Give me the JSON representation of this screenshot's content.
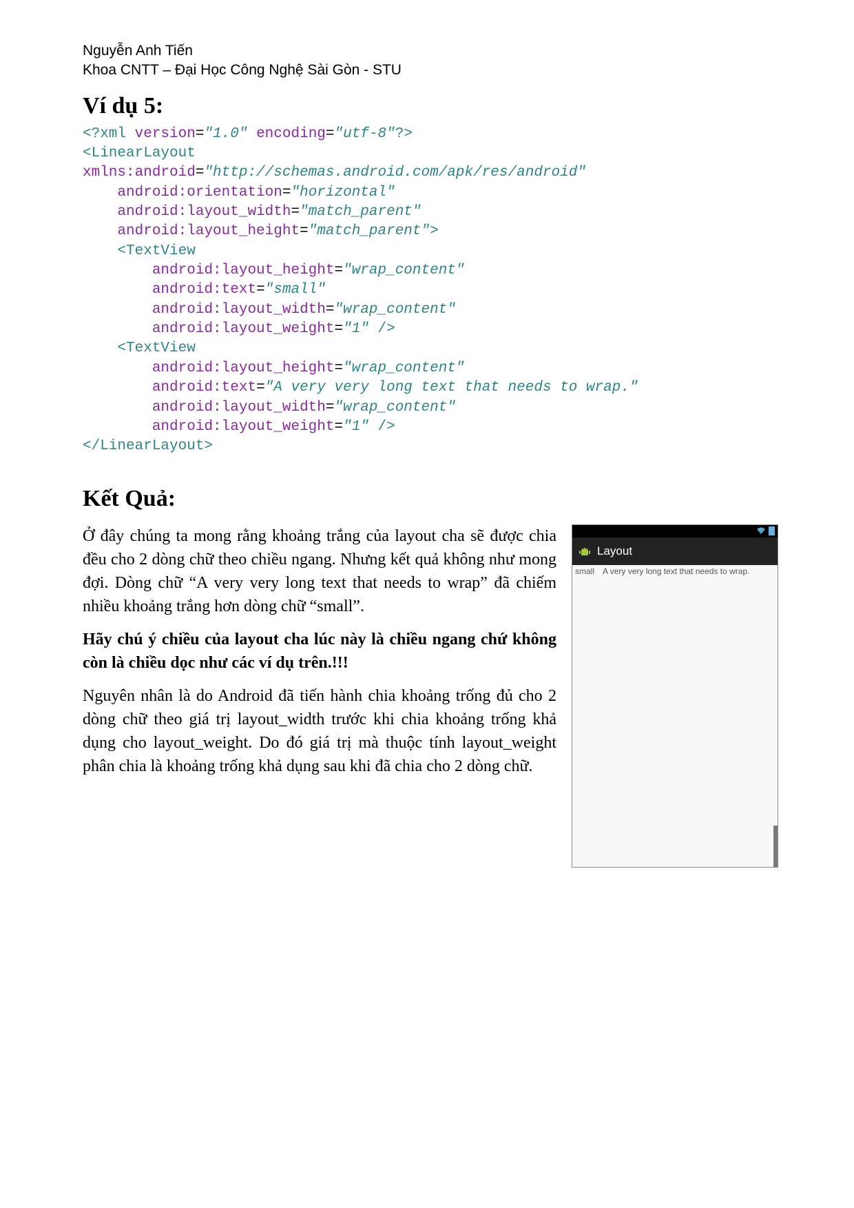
{
  "header": {
    "author": "Nguyễn Anh Tiến",
    "affiliation": "Khoa CNTT – Đại Học Công Nghệ Sài Gòn - STU"
  },
  "example_title": "Ví dụ 5:",
  "code": {
    "xml_decl_open": "<?xml ",
    "version_attr": "version",
    "version_val": "\"1.0\"",
    "encoding_attr": "encoding",
    "encoding_val": "\"utf-8\"",
    "xml_decl_close": "?>",
    "ll_open": "<LinearLayout",
    "xmlns_pref": "xmlns:android",
    "xmlns_val": "\"http://schemas.android.com/apk/res/android\"",
    "orient_attr": "android:orientation",
    "orient_val": "\"horizontal\"",
    "lw_attr": "android:layout_width",
    "lw_val_mp": "\"match_parent\"",
    "lh_attr": "android:layout_height",
    "lh_val_mp": "\"match_parent\"",
    "gt": ">",
    "tv_open": "<TextView",
    "lh_val_wc": "\"wrap_content\"",
    "text_attr": "android:text",
    "text_val_small": "\"small\"",
    "text_val_long": "\"A very very long text that needs to wrap.\"",
    "lw_val_wc": "\"wrap_content\"",
    "lwt_attr": "android:layout_weight",
    "lwt_val_1": "\"1\"",
    "sc": " />",
    "ll_close": "</LinearLayout>"
  },
  "result_title": "Kết Quả:",
  "paragraphs": {
    "p1": "Ở đây chúng ta mong rằng khoảng trắng của layout cha sẽ được chia đều cho 2 dòng chữ theo chiều ngang. Nhưng kết quả không như mong đợi. Dòng chữ “A very very long text that needs to wrap” đã chiếm nhiều khoảng trắng hơn dòng chữ “small”.",
    "p2_bold": "Hãy chú ý chiều của layout cha lúc này là chiều ngang chứ không còn là chiều dọc như các ví dụ trên.!!!",
    "p3": "Nguyên nhân là do Android đã tiến hành chia khoảng trống đủ cho 2 dòng chữ theo giá trị layout_width trước khi chia khoảng trống khả dụng cho layout_weight. Do đó giá trị mà thuộc tính layout_weight phân chia là khoảng trống khả dụng sau khi đã chia cho 2 dòng chữ."
  },
  "phone": {
    "title": "Layout",
    "text_small": "small",
    "text_long": "A very very long text that needs to wrap."
  }
}
